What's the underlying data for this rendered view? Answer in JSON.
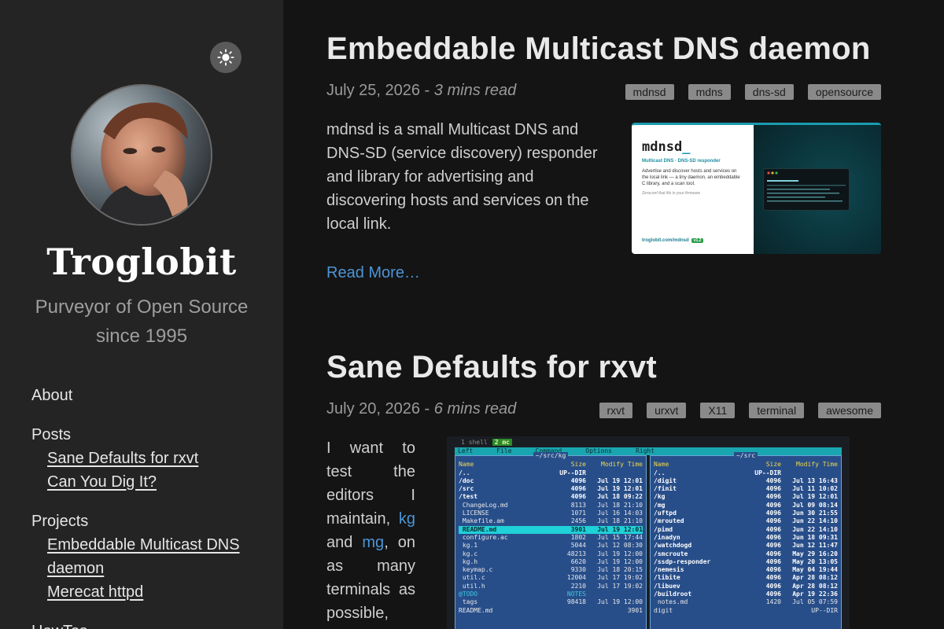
{
  "sidebar": {
    "site_title": "Troglobit",
    "tagline": "Purveyor of Open Source since 1995",
    "nav": {
      "about": "About",
      "posts": "Posts",
      "posts_items": [
        "Sane Defaults for rxvt",
        "Can You Dig It?"
      ],
      "projects": "Projects",
      "projects_items": [
        "Embeddable Multicast DNS daemon",
        "Merecat httpd"
      ],
      "howtos": "HowTos"
    }
  },
  "posts": [
    {
      "title": "Embeddable Multicast DNS daemon",
      "date": "July 25, 2026",
      "separator": "-",
      "read_time": "3 mins read",
      "tags": [
        "mdnsd",
        "mdns",
        "dns-sd",
        "opensource"
      ],
      "excerpt": "mdnsd is a small Multicast DNS and DNS-SD (service discovery) responder and library for advertising and discovering hosts and services on the local link.",
      "read_more": "Read More…",
      "thumbnail": {
        "brand": "mdnsd",
        "cursor": "_",
        "subtitle": "Multicast DNS · DNS-SD responder",
        "description": "Advertise and discover hosts and services on the local link — a tiny daemon, an embeddable C library, and a scan tool.",
        "note": "Zeroconf that fits in your firmware",
        "url": "troglobit.com/mdnsd",
        "version": "v1.2"
      }
    },
    {
      "title": "Sane Defaults for rxvt",
      "date": "July 20, 2026",
      "separator": "-",
      "read_time": "6 mins read",
      "tags": [
        "rxvt",
        "urxvt",
        "X11",
        "terminal",
        "awesome"
      ],
      "excerpt_parts": {
        "before": "I want to test the editors I maintain,",
        "link1": "kg",
        "and": "and",
        "link2": "mg",
        "after": ", on as many terminals as possible,"
      },
      "screenshot": {
        "tab1": "1 shell",
        "tab2": "2 mc",
        "menu": [
          "Left",
          "File",
          "Command",
          "Options",
          "Right"
        ],
        "left_path": "~/src/kg",
        "right_path": "~/src",
        "columns": [
          "Name",
          "Size",
          "Modify Time"
        ],
        "left_rows": [
          [
            "/..",
            "UP--DIR",
            ""
          ],
          [
            "/doc",
            "4096",
            "Jul 19 12:01"
          ],
          [
            "/src",
            "4096",
            "Jul 19 12:01"
          ],
          [
            "/test",
            "4096",
            "Jul 18 09:22"
          ],
          [
            " ChangeLog.md",
            "8113",
            "Jul 18 21:10"
          ],
          [
            " LICENSE",
            "1071",
            "Jul 16 14:03"
          ],
          [
            " Makefile.am",
            "2456",
            "Jul 18 21:10"
          ],
          [
            " README.md",
            "3901",
            "Jul 19 12:01"
          ],
          [
            " configure.ac",
            "1802",
            "Jul 15 17:44"
          ],
          [
            " kg.1",
            "5044",
            "Jul 12 08:30"
          ],
          [
            " kg.c",
            "48213",
            "Jul 19 12:00"
          ],
          [
            " kg.h",
            "6620",
            "Jul 19 12:00"
          ],
          [
            " keymap.c",
            "9330",
            "Jul 18 20:15"
          ],
          [
            " util.c",
            "12004",
            "Jul 17 19:02"
          ],
          [
            " util.h",
            "2210",
            "Jul 17 19:02"
          ],
          [
            "@TODO",
            "NOTES",
            ""
          ],
          [
            " tags",
            "98418",
            "Jul 19 12:00"
          ],
          [
            "README.md",
            "",
            "3901"
          ]
        ],
        "right_rows": [
          [
            "/..",
            "UP--DIR",
            ""
          ],
          [
            "/digit",
            "4096",
            "Jul 13 16:43"
          ],
          [
            "/finit",
            "4096",
            "Jul 11 10:02"
          ],
          [
            "/kg",
            "4096",
            "Jul 19 12:01"
          ],
          [
            "/mg",
            "4096",
            "Jul 09 08:14"
          ],
          [
            "/uftpd",
            "4096",
            "Jun 30 21:55"
          ],
          [
            "/mrouted",
            "4096",
            "Jun 22 14:10"
          ],
          [
            "/pimd",
            "4096",
            "Jun 22 14:10"
          ],
          [
            "/inadyn",
            "4096",
            "Jun 18 09:31"
          ],
          [
            "/watchdogd",
            "4096",
            "Jun 12 11:47"
          ],
          [
            "/smcroute",
            "4096",
            "May 29 16:20"
          ],
          [
            "/ssdp-responder",
            "4096",
            "May 20 13:05"
          ],
          [
            "/nemesis",
            "4096",
            "May 04 19:44"
          ],
          [
            "/libite",
            "4096",
            "Apr 28 08:12"
          ],
          [
            "/libuev",
            "4096",
            "Apr 28 08:12"
          ],
          [
            "/buildroot",
            "4096",
            "Apr 19 22:36"
          ],
          [
            " notes.md",
            "1420",
            "Jul 05 07:59"
          ],
          [
            "digit",
            "",
            "UP--DIR"
          ]
        ]
      }
    }
  ],
  "colors": {
    "sidebar_bg": "#242424",
    "main_bg": "#141414",
    "link": "#4d94d6",
    "tag_bg": "#8a8a8a"
  },
  "icons": {
    "theme_toggle": "sun-icon"
  }
}
